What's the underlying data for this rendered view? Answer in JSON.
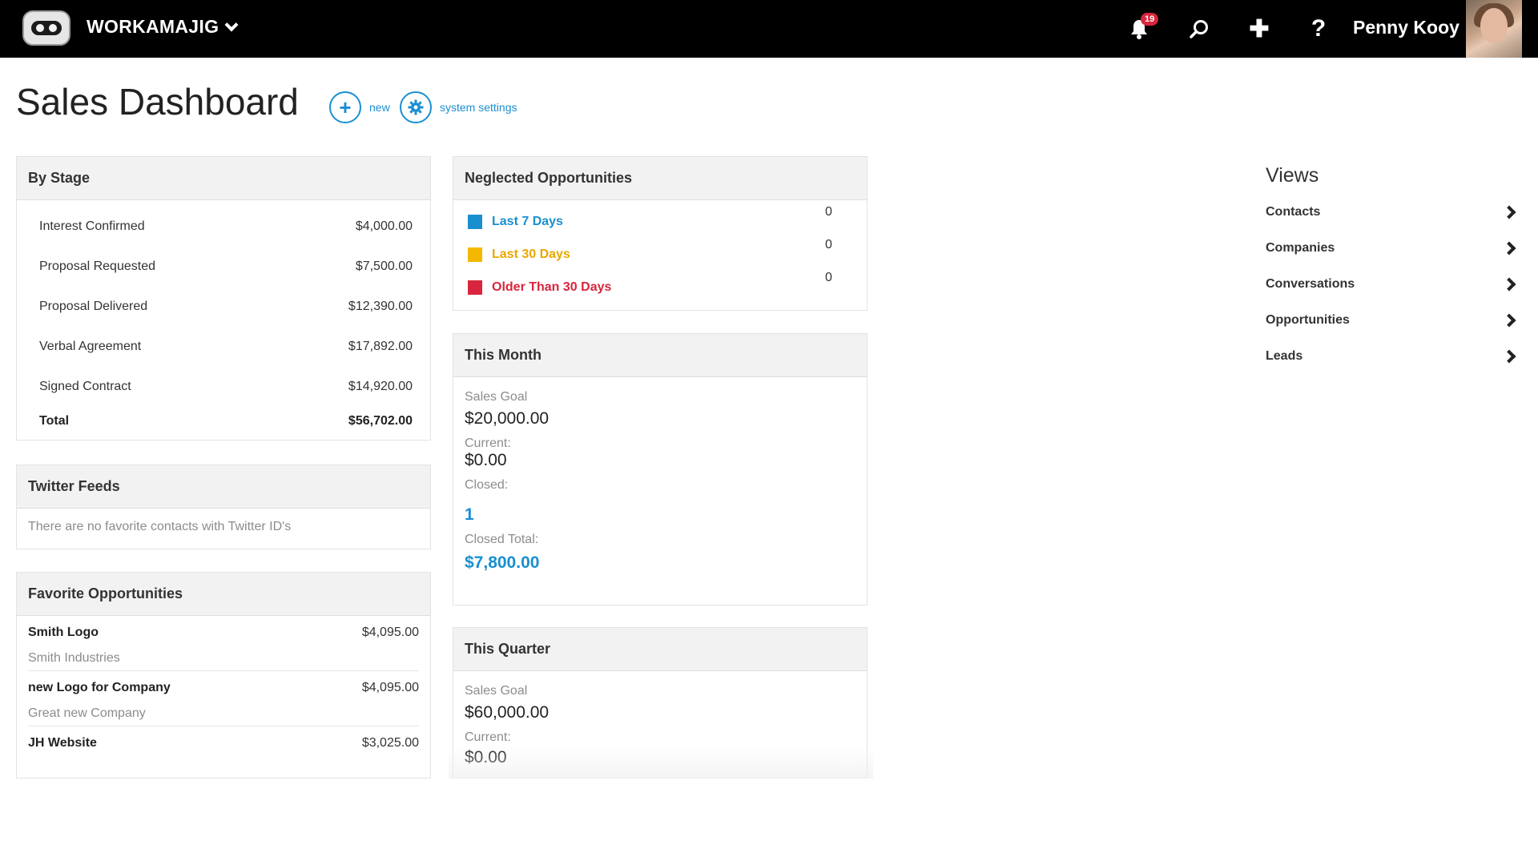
{
  "topbar": {
    "app_name": "WORKAMAJIG",
    "notifications_count": "19",
    "help_label": "?",
    "add_label": "✚",
    "user_name": "Penny Kooy"
  },
  "header": {
    "title": "Sales Dashboard",
    "new_label": "new",
    "settings_label": "system settings"
  },
  "by_stage": {
    "title": "By Stage",
    "rows": [
      {
        "label": "Interest Confirmed",
        "value": "$4,000.00",
        "amount": 4000
      },
      {
        "label": "Proposal Requested",
        "value": "$7,500.00",
        "amount": 7500
      },
      {
        "label": "Proposal Delivered",
        "value": "$12,390.00",
        "amount": 12390
      },
      {
        "label": "Verbal Agreement",
        "value": "$17,892.00",
        "amount": 17892
      },
      {
        "label": "Signed Contract",
        "value": "$14,920.00",
        "amount": 14920
      }
    ],
    "total_label": "Total",
    "total_value": "$56,702.00"
  },
  "twitter": {
    "title": "Twitter Feeds",
    "empty_text": "There are no favorite contacts with Twitter ID's"
  },
  "favorites": {
    "title": "Favorite Opportunities",
    "items": [
      {
        "name": "Smith Logo",
        "amount": "$4,095.00",
        "company": "Smith Industries"
      },
      {
        "name": "new Logo for Company",
        "amount": "$4,095.00",
        "company": "Great new Company"
      },
      {
        "name": "JH Website",
        "amount": "$3,025.00",
        "company": ""
      }
    ]
  },
  "neglected": {
    "title": "Neglected Opportunities",
    "rows": [
      {
        "label": "Last 7 Days",
        "count": "0",
        "color": "#1a8fd0"
      },
      {
        "label": "Last 30 Days",
        "count": "0",
        "color": "#f5b800"
      },
      {
        "label": "Older Than 30 Days",
        "count": "0",
        "color": "#d7263d"
      }
    ]
  },
  "this_month": {
    "title": "This Month",
    "sales_goal_label": "Sales Goal",
    "sales_goal": "$20,000.00",
    "current_label": "Current:",
    "current": "$0.00",
    "closed_label": "Closed:",
    "closed": "1",
    "closed_total_label": "Closed Total:",
    "closed_total": "$7,800.00"
  },
  "this_quarter": {
    "title": "This Quarter",
    "sales_goal_label": "Sales Goal",
    "sales_goal": "$60,000.00",
    "current_label": "Current:",
    "current": "$0.00"
  },
  "views": {
    "title": "Views",
    "items": [
      "Contacts",
      "Companies",
      "Conversations",
      "Opportunities",
      "Leads"
    ]
  },
  "colors": {
    "accent": "#1a8fd0",
    "topbar": "#000000"
  }
}
